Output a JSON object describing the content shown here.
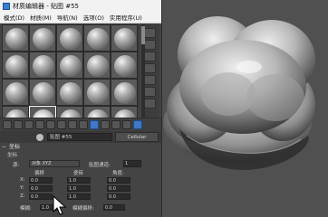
{
  "window": {
    "title": "材质编辑器 - 贴图 #55",
    "menu": [
      "模式(D)",
      "材质(M)",
      "导航(N)",
      "选项(O)",
      "实用程序(U)"
    ]
  },
  "slots": {
    "rows": 4,
    "cols": 5,
    "selected_index": 16
  },
  "map": {
    "name": "贴图 #55",
    "type_button": "Cellular"
  },
  "coords": {
    "rollout_title": "坐标",
    "section_label": "坐标",
    "source_label": "源:",
    "source_value": "对象 XYZ",
    "channel_label": "贴图通道:",
    "channel_value": "1",
    "col_offset": "偏移",
    "col_tiling": "瓷砖",
    "col_angle": "角度:",
    "rows": [
      {
        "axis": "X:",
        "offset": "0.0",
        "tiling": "1.0",
        "angle": "0.0"
      },
      {
        "axis": "Y:",
        "offset": "0.0",
        "tiling": "1.0",
        "angle": "0.0"
      },
      {
        "axis": "Z:",
        "offset": "0.0",
        "tiling": "1.0",
        "angle": "0.0"
      }
    ],
    "blur_label": "模糊:",
    "blur_value": "1.0",
    "blur_offset_label": "模糊偏移:",
    "blur_offset_value": "0.0"
  }
}
